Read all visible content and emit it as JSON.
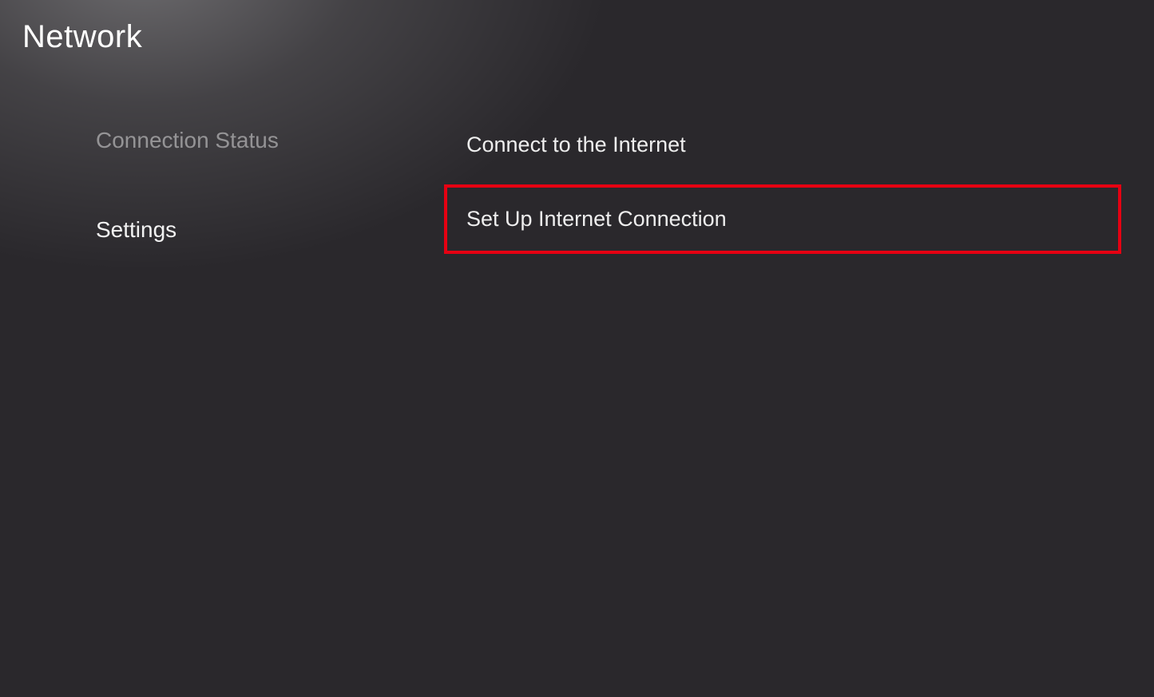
{
  "header": {
    "title": "Network"
  },
  "sidebar": {
    "items": [
      {
        "label": "Connection Status",
        "active": false
      },
      {
        "label": "Settings",
        "active": true
      }
    ]
  },
  "main": {
    "options": [
      {
        "label": "Connect to the Internet",
        "highlighted": false
      },
      {
        "label": "Set Up Internet Connection",
        "highlighted": true
      }
    ]
  }
}
